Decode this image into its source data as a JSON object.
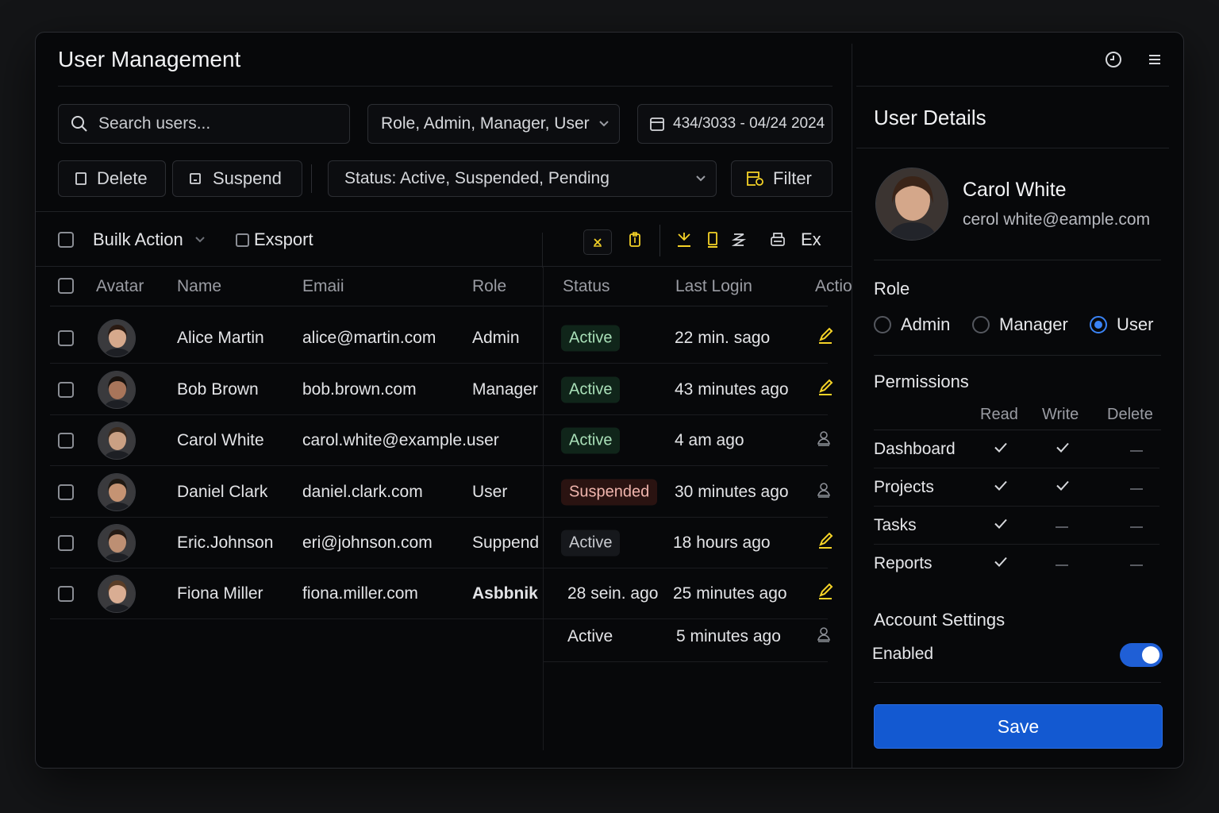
{
  "app": {
    "title": "User Management"
  },
  "search": {
    "placeholder": "Search users..."
  },
  "filters": {
    "role": "Role, Admin, Manager, User",
    "date_range": "434/3033 - 04/24 2024",
    "status": "Status:  Active, Suspended, Pending",
    "filter_label": "Filter"
  },
  "actions": {
    "delete": "Delete",
    "suspend": "Suspend"
  },
  "toolbar": {
    "bulk_action": "Builk Action",
    "export": "Exsport",
    "ex": "Ex"
  },
  "table": {
    "headers": {
      "avatar": "Avatar",
      "name": "Name",
      "email": "Emaii",
      "role": "Role",
      "status": "Status",
      "last_login": "Last Login",
      "actions": "Actio"
    },
    "rows": [
      {
        "name": "Alice Martin",
        "email": "alice@martin.com",
        "role": "Admin",
        "status": "Active",
        "status_style": "active",
        "last_login": "22  min.  sago",
        "action_icon": "edit-icon"
      },
      {
        "name": "Bob Brown",
        "email": "bob.brown.com",
        "role": "Manager",
        "status": "Active",
        "status_style": "active",
        "last_login": "43 minutes ago",
        "action_icon": "edit-icon"
      },
      {
        "name": "Carol White",
        "email": "carol.white@example.user",
        "role": "",
        "status": "Active",
        "status_style": "active",
        "last_login": "4 am  ago",
        "action_icon": "user-icon"
      },
      {
        "name": "Daniel Clark",
        "email": "daniel.clark.com",
        "role": "User",
        "status": "Suspended",
        "status_style": "suspended",
        "last_login": "30 minutes ago",
        "action_icon": "user-icon"
      },
      {
        "name": "Eric.Johnson",
        "email": "eri@johnson.com",
        "role": "Suppend",
        "status": "Active",
        "status_style": "neutral",
        "last_login": "18 hours ago",
        "action_icon": "edit-icon"
      },
      {
        "name": "Fiona Miller",
        "email": "fiona.miller.com",
        "role": "Asbbnik",
        "status": "28 sein. ago",
        "status_style": "plain",
        "last_login": "25 minutes ago",
        "action_icon": "edit-icon"
      }
    ],
    "extra_row": {
      "status": "Active",
      "last_login": "5 minutes ago",
      "action_icon": "user-icon"
    }
  },
  "details": {
    "title": "User Details",
    "user_name": "Carol White",
    "user_email": "cerol white@eample.com",
    "role_label": "Role",
    "roles": [
      "Admin",
      "Manager",
      "User"
    ],
    "selected_role": "User",
    "permissions_label": "Permissions",
    "perm_columns": [
      "Read",
      "Write",
      "Delete"
    ],
    "permissions": [
      {
        "name": "Dashboard",
        "read": true,
        "write": true,
        "delete": false
      },
      {
        "name": "Projects",
        "read": true,
        "write": true,
        "delete": false
      },
      {
        "name": "Tasks",
        "read": true,
        "write": false,
        "delete": false
      },
      {
        "name": "Reports",
        "read": true,
        "write": false,
        "delete": false
      }
    ],
    "account_settings_label": "Account Settings",
    "enabled_label": "Enabled",
    "enabled": true,
    "save_label": "Save"
  },
  "colors": {
    "accent": "#1359d1",
    "active_pill": "#10251a",
    "suspended_pill": "#2a1311",
    "icon_yellow": "#f5d327"
  }
}
